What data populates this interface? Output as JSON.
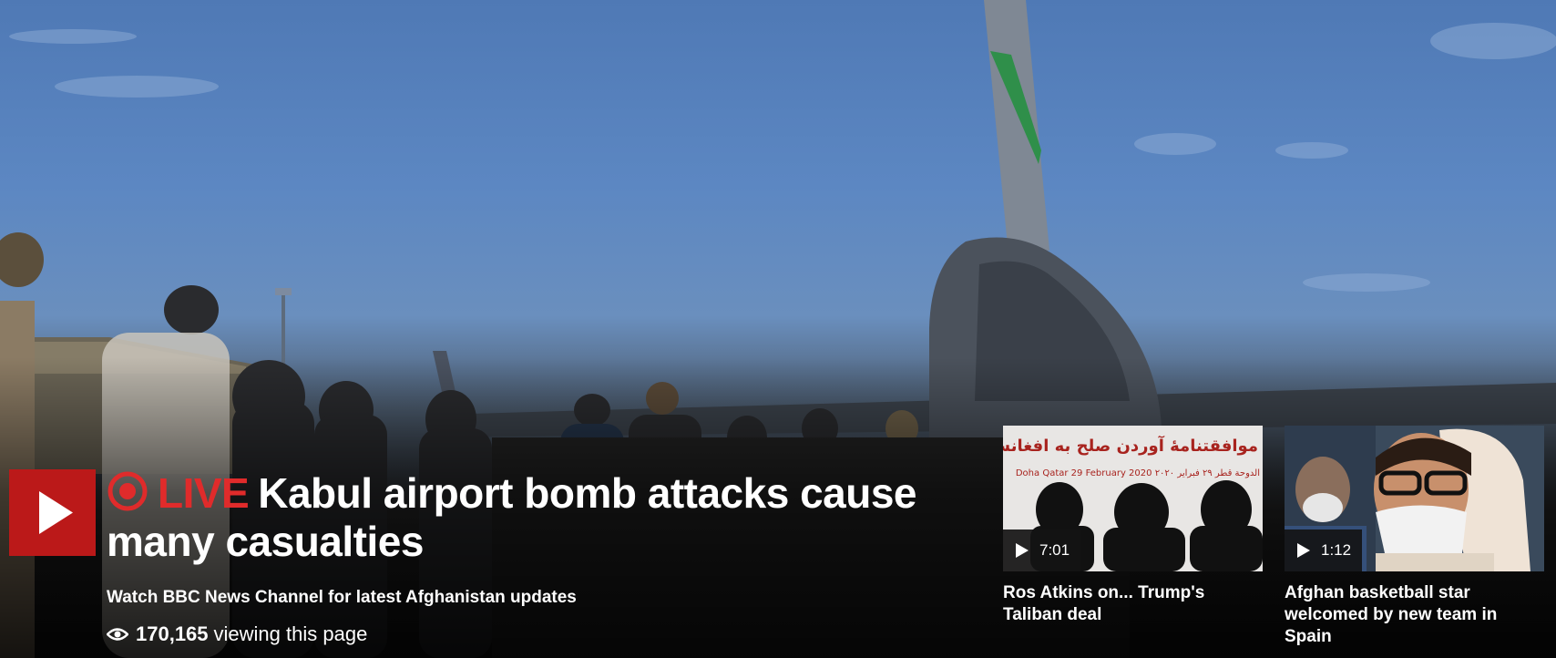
{
  "hero": {
    "live_label": "LIVE",
    "headline": "Kabul airport bomb attacks cause many casualties",
    "subline": "Watch BBC News Channel for latest Afghanistan updates",
    "viewer_count": "170,165",
    "viewer_suffix": "viewing this page",
    "icons": {
      "play": "play-icon",
      "live": "live-indicator-icon",
      "eye": "eye-icon"
    }
  },
  "videos": [
    {
      "duration": "7:01",
      "title": "Ros Atkins on... Trump's Taliban deal",
      "thumb_text_arabic": "موافقتنامۀ آوردن صلح به افغانستان",
      "thumb_text_date": "Doha Qatar 29 February 2020 الدوحة قطر ٢٩ فبراير ٢٠٢٠"
    },
    {
      "duration": "1:12",
      "title": "Afghan basketball star welcomed by new team in Spain"
    }
  ],
  "colors": {
    "brand_red": "#bb1919",
    "live_red": "#e02b2b",
    "text": "#ffffff"
  }
}
